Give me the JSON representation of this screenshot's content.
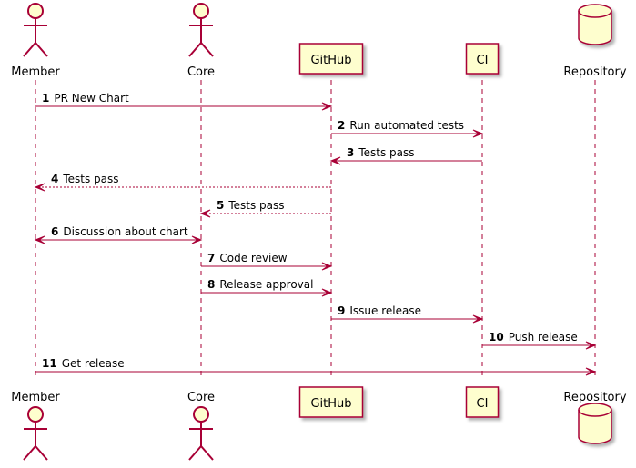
{
  "diagram": {
    "type": "sequence",
    "colors": {
      "line": "#A80036",
      "fill": "#FEFECE",
      "shadow": "#c8c8c8",
      "text": "#000000"
    },
    "participants": [
      {
        "id": "member",
        "label": "Member",
        "kind": "actor"
      },
      {
        "id": "core",
        "label": "Core",
        "kind": "actor"
      },
      {
        "id": "github",
        "label": "GitHub",
        "kind": "participant"
      },
      {
        "id": "ci",
        "label": "CI",
        "kind": "participant"
      },
      {
        "id": "repository",
        "label": "Repository",
        "kind": "database"
      }
    ],
    "messages": [
      {
        "num": "1",
        "text": "PR New Chart",
        "from": "member",
        "to": "github",
        "style": "solid"
      },
      {
        "num": "2",
        "text": "Run automated tests",
        "from": "github",
        "to": "ci",
        "style": "solid"
      },
      {
        "num": "3",
        "text": "Tests pass",
        "from": "ci",
        "to": "github",
        "style": "solid"
      },
      {
        "num": "4",
        "text": "Tests pass",
        "from": "github",
        "to": "member",
        "style": "dashed"
      },
      {
        "num": "5",
        "text": "Tests pass",
        "from": "github",
        "to": "core",
        "style": "dashed"
      },
      {
        "num": "6",
        "text": "Discussion about chart",
        "from": "member",
        "to": "core",
        "style": "bidirectional"
      },
      {
        "num": "7",
        "text": "Code review",
        "from": "core",
        "to": "github",
        "style": "solid"
      },
      {
        "num": "8",
        "text": "Release approval",
        "from": "core",
        "to": "github",
        "style": "solid"
      },
      {
        "num": "9",
        "text": "Issue release",
        "from": "github",
        "to": "ci",
        "style": "solid"
      },
      {
        "num": "10",
        "text": "Push release",
        "from": "ci",
        "to": "repository",
        "style": "solid"
      },
      {
        "num": "11",
        "text": "Get release",
        "from": "member",
        "to": "repository",
        "style": "solid"
      }
    ]
  }
}
